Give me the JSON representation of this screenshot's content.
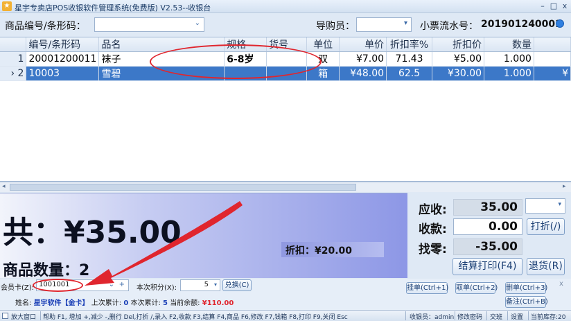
{
  "window": {
    "title": "星宇专卖店POS收银软件管理系统(免费版) V2.53--收银台",
    "minimize": "–",
    "maximize": "□",
    "close": "x"
  },
  "topbar": {
    "product_label": "商品编号/条形码：",
    "product_value": "",
    "guide_label": "导购员：",
    "guide_value": "",
    "serial_label": "小票流水号：",
    "serial_value": "201901240001"
  },
  "grid": {
    "columns": [
      "编号/条形码",
      "品名",
      "规格",
      "货号",
      "单位",
      "单价",
      "折扣率%",
      "折扣价",
      "数量"
    ],
    "rows": [
      {
        "index": "1",
        "marker": "",
        "code": "20001200011",
        "name": "袜子",
        "spec": "6-8岁",
        "sku": "",
        "unit": "双",
        "price": "¥7.00",
        "rate": "71.43",
        "disc_price": "¥5.00",
        "qty": "1.000",
        "extra": ""
      },
      {
        "index": "2",
        "marker": "›",
        "code": "10003",
        "name": "雪碧",
        "spec": "",
        "sku": "",
        "unit": "箱",
        "price": "¥48.00",
        "rate": "62.5",
        "disc_price": "¥30.00",
        "qty": "1.000",
        "extra": "¥"
      }
    ]
  },
  "summary": {
    "total_text": "共：¥35.00",
    "qty_text": "商品数量：2",
    "discount_text": "折扣：¥20.00"
  },
  "money": {
    "due_label": "应收:",
    "due_value": "35.00",
    "paid_label": "收款:",
    "paid_value": "0.00",
    "change_label": "找零:",
    "change_value": "-35.00",
    "discount_btn": "打折(/)",
    "checkout_btn": "结算打印(F4)",
    "return_btn": "退货(R)"
  },
  "member": {
    "card_label": "会员卡(Z):",
    "card_value": "1001001",
    "points_label": "本次积分(X):",
    "points_value": "5",
    "exchange_btn": "兑换(C)",
    "hold_btn": "挂单(Ctrl+1)",
    "fetch_btn": "取单(Ctrl+2)",
    "delete_btn": "删单(Ctrl+3)",
    "note_btn": "备注(Ctrl+B)",
    "close_x": "x",
    "name_label": "姓名:",
    "name_value": "星宇软件【金卡】",
    "last_total_label": "上次累计:",
    "last_total_value": "0",
    "this_total_label": "本次累计:",
    "this_total_value": "5",
    "balance_label": "当前余额:",
    "balance_value": "¥110.00"
  },
  "status": {
    "zoom": "放大窗口",
    "help": "帮助 F1, 增加 +,减少 -,删行 Del,打折 /,录入 F2,收款 F3,结算 F4,商品 F6,修改 F7,钱箱 F8,打印 F9,关闭 Esc",
    "cashier": "收银员：admin",
    "change_pwd": "修改密码",
    "shift": "交班",
    "settings": "设置",
    "stock": "当前库存:20"
  },
  "colors": {
    "selected_row": "#3c78c8",
    "annotation_red": "#e0262e",
    "member_blue": "#1a3fb6"
  }
}
